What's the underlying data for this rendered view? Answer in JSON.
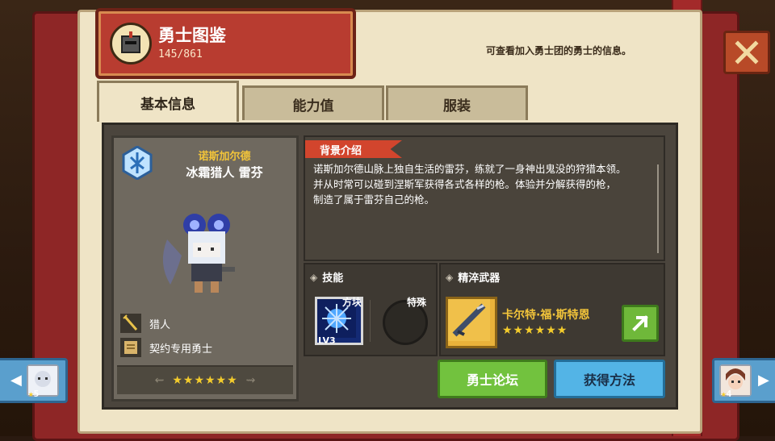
{
  "header": {
    "title": "勇士图鉴",
    "count": "145/861",
    "subtitle": "可查看加入勇士团的勇士的信息。"
  },
  "tabs": [
    {
      "label": "基本信息",
      "active": true
    },
    {
      "label": "能力值",
      "active": false
    },
    {
      "label": "服装",
      "active": false
    }
  ],
  "hero": {
    "region": "诺斯加尔德",
    "name": "冰霜猎人 雷芬",
    "class_label": "猎人",
    "contract_label": "契约专用勇士",
    "stars": "★★★★★★"
  },
  "background": {
    "label": "背景介绍",
    "text_lines": [
      "诺斯加尔德山脉上独自生活的雷芬，练就了一身神出鬼没的狩猎本领。",
      "并从时常可以碰到涅斯军获得各式各样的枪。体验并分解获得的枪，",
      "制造了属于雷芬自己的枪。"
    ]
  },
  "skill": {
    "label": "技能",
    "skill_name": "方块",
    "level": "LV3",
    "special_name": "特殊"
  },
  "weapon": {
    "label": "精淬武器",
    "name": "卡尔特·福·斯特恩",
    "stars": "★★★★★★"
  },
  "buttons": {
    "forum": "勇士论坛",
    "obtain": "获得方法"
  },
  "nav": {
    "prev_stars": "5",
    "next_stars": "4",
    "star_glyph": "★"
  },
  "colors": {
    "title_plate": "#b83c30",
    "forum_button": "#72c23e",
    "obtain_button": "#53b4e6",
    "star": "#f4cc2c",
    "region": "#f2c43a"
  }
}
